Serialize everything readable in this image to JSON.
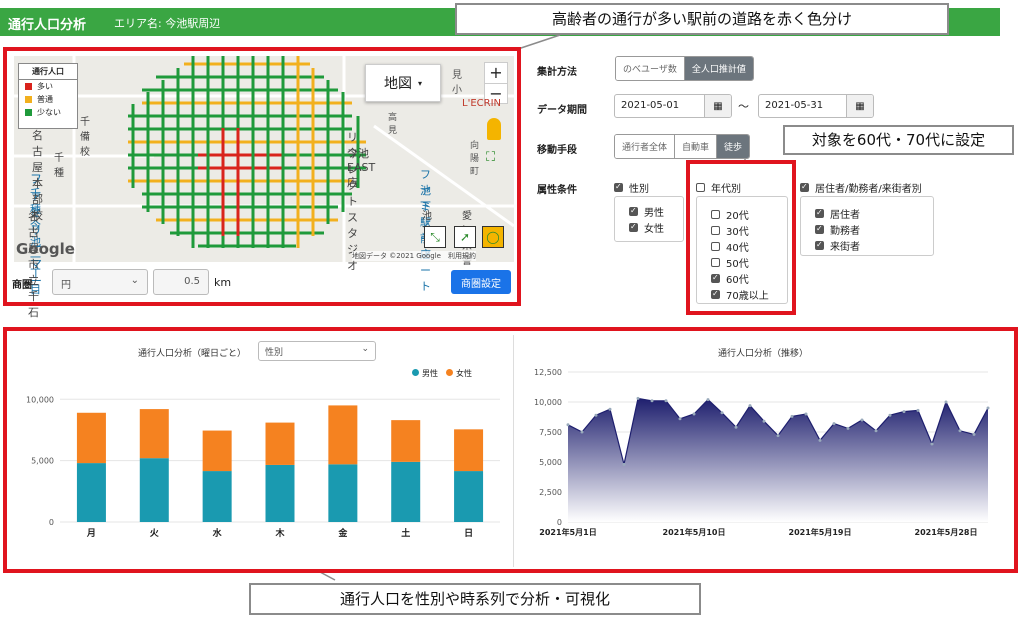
{
  "header": {
    "title": "通行人口分析",
    "area": "エリア名: 今池駅周辺"
  },
  "callouts": {
    "top": "高齢者の通行が多い駅前の道路を赤く色分け",
    "age": "対象を60代・70代に設定",
    "bottom": "通行人口を性別や時系列で分析・可視化"
  },
  "map": {
    "legend_title": "通行人口",
    "legend": [
      {
        "label": "多い",
        "color": "#d9231c"
      },
      {
        "label": "普通",
        "color": "#f2b01e"
      },
      {
        "label": "少ない",
        "color": "#1f9a3b"
      }
    ],
    "map_type": "地図",
    "zoom_in": "+",
    "zoom_out": "−",
    "google": "Google",
    "attribution": "地図データ ©2021 Google　利用規約",
    "labels": [
      "見小",
      "L'ECRIN",
      "高見",
      "リフレクトスタジオ",
      "今池EAST店",
      "向陽町",
      "ファミリーマー",
      "千種今池一丁目",
      "ファミリーマート",
      "池下駅前店",
      "名古屋市立千石",
      "池下",
      "愛知県警",
      "名古屋本部校",
      "千種",
      "千備校"
    ],
    "shoken_label": "商圏",
    "shape_select": "円",
    "radius_value": "0.5",
    "radius_unit": "km",
    "set_button": "商圏設定"
  },
  "form": {
    "agg_label": "集計方法",
    "agg_options": [
      "のべユーザ数",
      "全人口推計値"
    ],
    "agg_selected": "全人口推計値",
    "period_label": "データ期間",
    "date_from": "2021-05-01",
    "date_to": "2021-05-31",
    "tilde": "～",
    "transport_label": "移動手段",
    "transport_options": [
      "通行者全体",
      "自動車",
      "徒歩"
    ],
    "transport_selected": "徒歩",
    "attr_label": "属性条件",
    "gender": {
      "label": "性別",
      "checked": true,
      "items": [
        {
          "label": "男性",
          "checked": true
        },
        {
          "label": "女性",
          "checked": true
        }
      ]
    },
    "age": {
      "label": "年代別",
      "checked": false,
      "items": [
        {
          "label": "20代",
          "checked": false
        },
        {
          "label": "30代",
          "checked": false
        },
        {
          "label": "40代",
          "checked": false
        },
        {
          "label": "50代",
          "checked": false
        },
        {
          "label": "60代",
          "checked": true
        },
        {
          "label": "70歳以上",
          "checked": true
        }
      ]
    },
    "resident": {
      "label": "居住者/勤務者/来街者別",
      "checked": true,
      "items": [
        {
          "label": "居住者",
          "checked": true
        },
        {
          "label": "勤務者",
          "checked": true
        },
        {
          "label": "来街者",
          "checked": true
        }
      ]
    }
  },
  "chart_data": [
    {
      "type": "bar",
      "title": "通行人口分析（曜日ごと）",
      "selector": "性別",
      "categories": [
        "月",
        "火",
        "水",
        "木",
        "金",
        "土",
        "日"
      ],
      "series": [
        {
          "name": "男性",
          "color": "#1a9ab0",
          "values": [
            4800,
            5200,
            4150,
            4650,
            4700,
            4900,
            4150
          ]
        },
        {
          "name": "女性",
          "color": "#f58220",
          "values": [
            4100,
            4000,
            3300,
            3450,
            4800,
            3400,
            3400
          ]
        }
      ],
      "yticks": [
        "0",
        "5,000",
        "10,000"
      ],
      "ylim": [
        0,
        11000
      ],
      "stacked": true,
      "legend": "top-right"
    },
    {
      "type": "area",
      "title": "通行人口分析（推移）",
      "color": "#1e1f6e",
      "x": [
        "2021-05-01",
        "2021-05-02",
        "2021-05-03",
        "2021-05-04",
        "2021-05-05",
        "2021-05-06",
        "2021-05-07",
        "2021-05-08",
        "2021-05-09",
        "2021-05-10",
        "2021-05-11",
        "2021-05-12",
        "2021-05-13",
        "2021-05-14",
        "2021-05-15",
        "2021-05-16",
        "2021-05-17",
        "2021-05-18",
        "2021-05-19",
        "2021-05-20",
        "2021-05-21",
        "2021-05-22",
        "2021-05-23",
        "2021-05-24",
        "2021-05-25",
        "2021-05-26",
        "2021-05-27",
        "2021-05-28",
        "2021-05-29",
        "2021-05-30",
        "2021-05-31"
      ],
      "values": [
        8100,
        7500,
        8900,
        9400,
        4800,
        10300,
        10100,
        10100,
        8600,
        9000,
        10200,
        9100,
        7900,
        9700,
        8400,
        7200,
        8800,
        9000,
        6800,
        8200,
        7800,
        8500,
        7600,
        8900,
        9200,
        9300,
        6500,
        10000,
        7600,
        7300,
        9500
      ],
      "xticks": [
        "2021年5月1日",
        "2021年5月10日",
        "2021年5月19日",
        "2021年5月28日"
      ],
      "yticks": [
        "0",
        "2,500",
        "5,000",
        "7,500",
        "10,000",
        "12,500"
      ],
      "ylim": [
        0,
        12500
      ]
    }
  ]
}
